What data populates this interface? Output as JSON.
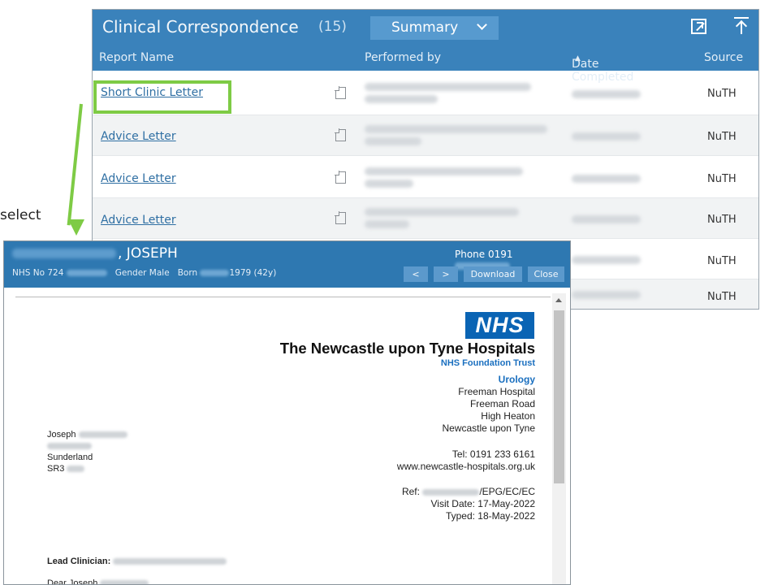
{
  "correspondence": {
    "title": "Clinical Correspondence",
    "count": "(15)",
    "summary_button": "Summary",
    "columns": {
      "report_name": "Report Name",
      "performed_by": "Performed by",
      "date_completed": "Date Completed",
      "sort_indicator": "▲",
      "source": "Source"
    },
    "rows": [
      {
        "report_name": "Short Clinic Letter",
        "source": "NuTH"
      },
      {
        "report_name": "Advice Letter",
        "source": "NuTH"
      },
      {
        "report_name": "Advice Letter",
        "source": "NuTH"
      },
      {
        "report_name": "Advice Letter",
        "source": "NuTH"
      },
      {
        "report_name": "",
        "source": "NuTH"
      },
      {
        "report_name": "",
        "source": "NuTH"
      }
    ]
  },
  "annotation": {
    "label": "select"
  },
  "viewer": {
    "patient_name": ", JOSEPH",
    "nhs_no_label": "NHS No 724",
    "gender": "Gender Male",
    "born_label": "Born",
    "born_year": "1979 (42y)",
    "phone_label": "Phone 0191",
    "buttons": {
      "prev": "<",
      "next": ">",
      "download": "Download",
      "close": "Close"
    },
    "letter": {
      "logo": "NHS",
      "trust_name": "The Newcastle upon Tyne Hospitals",
      "foundation": "NHS Foundation Trust",
      "department": "Urology",
      "address": [
        "Freeman Hospital",
        "Freeman Road",
        "High Heaton",
        "Newcastle upon Tyne"
      ],
      "tel": "Tel: 0191 233 6161",
      "website": "www.newcastle-hospitals.org.uk",
      "ref_label": "Ref:",
      "ref_suffix": "/EPG/EC/EC",
      "visit_date": "Visit Date: 17-May-2022",
      "typed": "Typed: 18-May-2022",
      "recipient_first": "Joseph",
      "recipient_town": "Sunderland",
      "recipient_postcode": "SR3",
      "lead_clinician_label": "Lead Clinician:",
      "salutation": "Dear Joseph"
    }
  }
}
